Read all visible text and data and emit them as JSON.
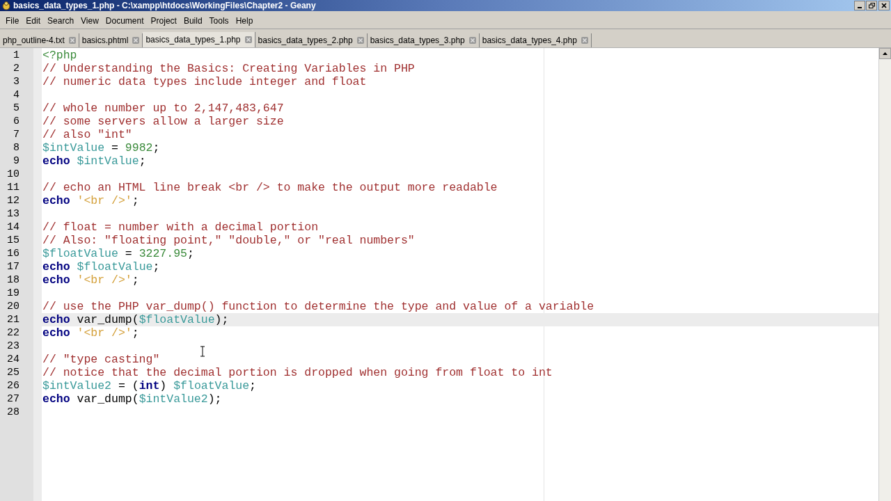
{
  "window": {
    "title": "basics_data_types_1.php - C:\\xampp\\htdocs\\WorkingFiles\\Chapter2 - Geany"
  },
  "menu": [
    "File",
    "Edit",
    "Search",
    "View",
    "Document",
    "Project",
    "Build",
    "Tools",
    "Help"
  ],
  "tabs": [
    {
      "label": "php_outline-4.txt",
      "selected": false
    },
    {
      "label": "basics.phtml",
      "selected": false
    },
    {
      "label": "basics_data_types_1.php",
      "selected": true
    },
    {
      "label": "basics_data_types_2.php",
      "selected": false
    },
    {
      "label": "basics_data_types_3.php",
      "selected": false
    },
    {
      "label": "basics_data_types_4.php",
      "selected": false
    }
  ],
  "editor": {
    "lines": [
      {
        "number": "1",
        "current": false,
        "tokens": [
          {
            "kind": "tag",
            "text": "<?php"
          }
        ]
      },
      {
        "number": "2",
        "current": false,
        "tokens": [
          {
            "kind": "comment",
            "text": "// Understanding the Basics: Creating Variables in PHP"
          }
        ]
      },
      {
        "number": "3",
        "current": false,
        "tokens": [
          {
            "kind": "comment",
            "text": "// numeric data types include integer and float"
          }
        ]
      },
      {
        "number": "4",
        "current": false
      },
      {
        "number": "5",
        "current": false,
        "tokens": [
          {
            "kind": "comment",
            "text": "// whole number up to 2,147,483,647"
          }
        ]
      },
      {
        "number": "6",
        "current": false,
        "tokens": [
          {
            "kind": "comment",
            "text": "// some servers allow a larger size"
          }
        ]
      },
      {
        "number": "7",
        "current": false,
        "tokens": [
          {
            "kind": "comment",
            "text": "// also \"int\""
          }
        ]
      },
      {
        "number": "8",
        "current": false,
        "tokens": [
          {
            "kind": "variable",
            "text": "$intValue"
          },
          {
            "kind": "plain",
            "text": " = "
          },
          {
            "kind": "number",
            "text": "9982"
          },
          {
            "kind": "plain",
            "text": ";"
          }
        ]
      },
      {
        "number": "9",
        "current": false,
        "tokens": [
          {
            "kind": "keyword",
            "text": "echo"
          },
          {
            "kind": "variable",
            "text": " $intValue"
          },
          {
            "kind": "plain",
            "text": ";"
          }
        ]
      },
      {
        "number": "10",
        "current": false
      },
      {
        "number": "11",
        "current": false,
        "tokens": [
          {
            "kind": "comment",
            "text": "// echo an HTML line break <br /> to make the output more readable"
          }
        ]
      },
      {
        "number": "12",
        "current": false,
        "tokens": [
          {
            "kind": "keyword",
            "text": "echo"
          },
          {
            "kind": "string",
            "text": " '<br />'"
          },
          {
            "kind": "plain",
            "text": ";"
          }
        ]
      },
      {
        "number": "13",
        "current": false
      },
      {
        "number": "14",
        "current": false,
        "tokens": [
          {
            "kind": "comment",
            "text": "// float = number with a decimal portion"
          }
        ]
      },
      {
        "number": "15",
        "current": false,
        "tokens": [
          {
            "kind": "comment",
            "text": "// Also: \"floating point,\" \"double,\" or \"real numbers\""
          }
        ]
      },
      {
        "number": "16",
        "current": false,
        "tokens": [
          {
            "kind": "variable",
            "text": "$floatValue"
          },
          {
            "kind": "plain",
            "text": " = "
          },
          {
            "kind": "number",
            "text": "3227.95"
          },
          {
            "kind": "plain",
            "text": ";"
          }
        ]
      },
      {
        "number": "17",
        "current": false,
        "tokens": [
          {
            "kind": "keyword",
            "text": "echo"
          },
          {
            "kind": "variable",
            "text": " $floatValue"
          },
          {
            "kind": "plain",
            "text": ";"
          }
        ]
      },
      {
        "number": "18",
        "current": false,
        "tokens": [
          {
            "kind": "keyword",
            "text": "echo"
          },
          {
            "kind": "string",
            "text": " '<br />'"
          },
          {
            "kind": "plain",
            "text": ";"
          }
        ]
      },
      {
        "number": "19",
        "current": false
      },
      {
        "number": "20",
        "current": false,
        "tokens": [
          {
            "kind": "comment",
            "text": "// use the PHP var_dump() function to determine the type and value of a variable"
          }
        ]
      },
      {
        "number": "21",
        "current": true,
        "tokens": [
          {
            "kind": "keyword",
            "text": "echo"
          },
          {
            "kind": "plain",
            "text": " var_dump("
          },
          {
            "kind": "variable",
            "text": "$floatValue"
          },
          {
            "kind": "plain",
            "text": ");"
          }
        ]
      },
      {
        "number": "22",
        "current": false,
        "tokens": [
          {
            "kind": "keyword",
            "text": "echo"
          },
          {
            "kind": "string",
            "text": " '<br />'"
          },
          {
            "kind": "plain",
            "text": ";"
          }
        ]
      },
      {
        "number": "23",
        "current": false
      },
      {
        "number": "24",
        "current": false,
        "tokens": [
          {
            "kind": "comment",
            "text": "// \"type casting\""
          }
        ]
      },
      {
        "number": "25",
        "current": false,
        "tokens": [
          {
            "kind": "comment",
            "text": "// notice that the decimal portion is dropped when going from float to int"
          }
        ]
      },
      {
        "number": "26",
        "current": false,
        "tokens": [
          {
            "kind": "variable",
            "text": "$intValue2"
          },
          {
            "kind": "plain",
            "text": " = ("
          },
          {
            "kind": "keyword",
            "text": "int"
          },
          {
            "kind": "plain",
            "text": ") "
          },
          {
            "kind": "variable",
            "text": "$floatValue"
          },
          {
            "kind": "plain",
            "text": ";"
          }
        ]
      },
      {
        "number": "27",
        "current": false,
        "tokens": [
          {
            "kind": "keyword",
            "text": "echo"
          },
          {
            "kind": "plain",
            "text": " var_dump("
          },
          {
            "kind": "variable",
            "text": "$intValue2"
          },
          {
            "kind": "plain",
            "text": ");"
          }
        ]
      },
      {
        "number": "28",
        "current": false
      }
    ]
  }
}
